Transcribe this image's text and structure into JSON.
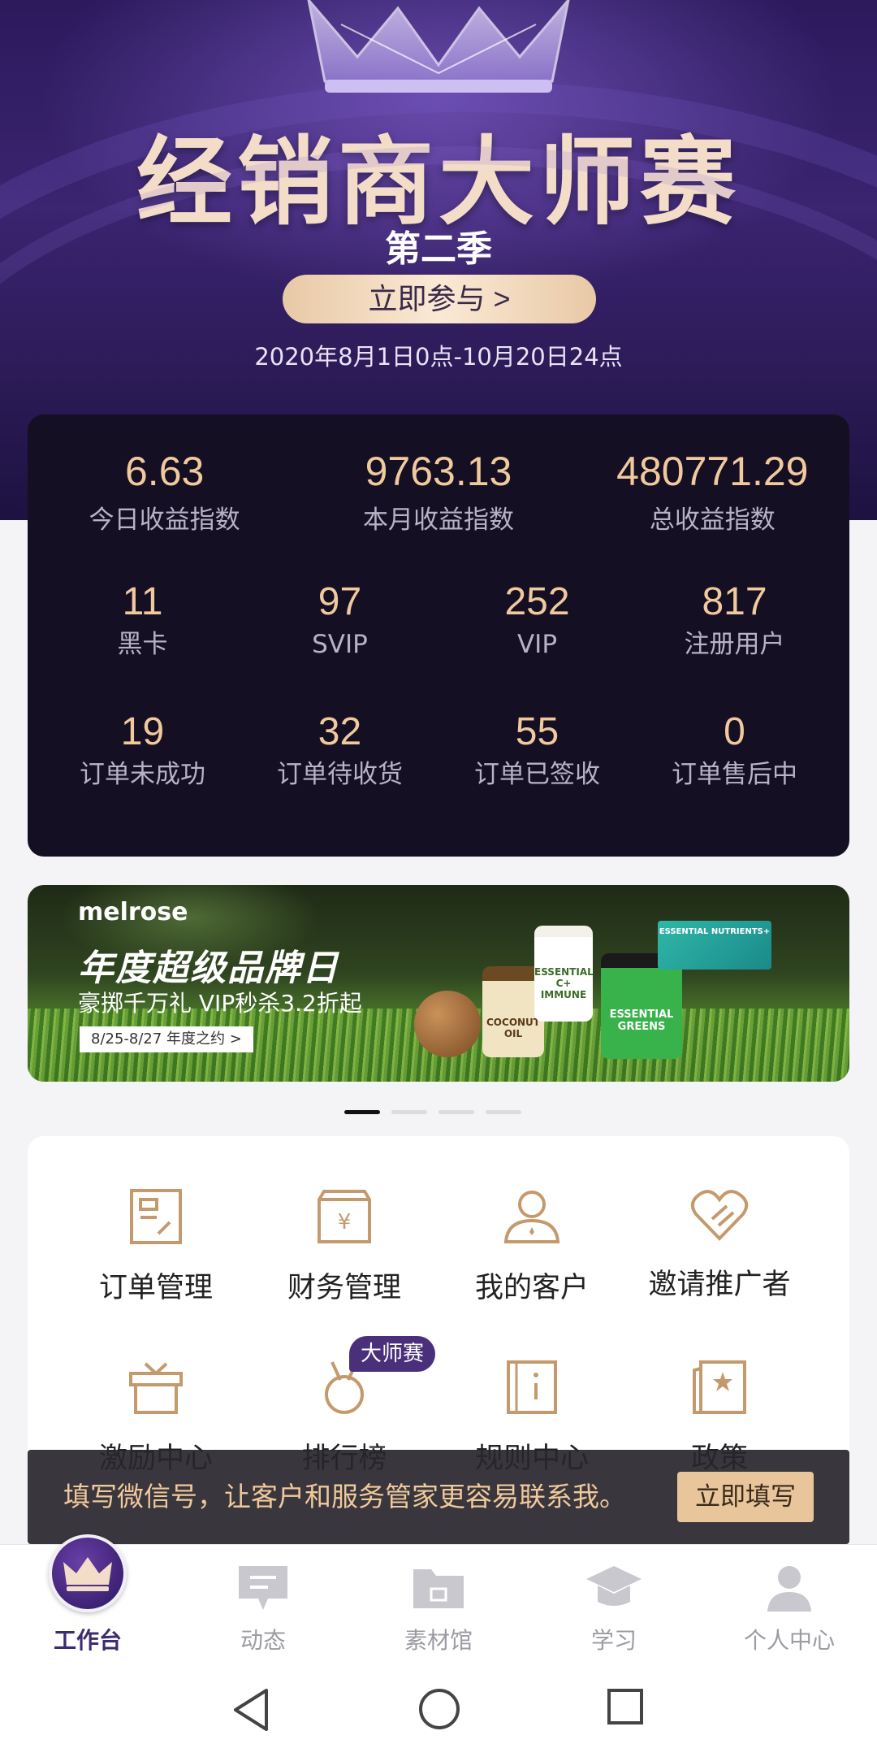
{
  "hero": {
    "title": "经销商大师赛",
    "subtitle": "第二季",
    "join_button": "立即参与 >",
    "date_range": "2020年8月1日0点-10月20日24点"
  },
  "stats": {
    "top": [
      {
        "value": "6.63",
        "label": "今日收益指数"
      },
      {
        "value": "9763.13",
        "label": "本月收益指数"
      },
      {
        "value": "480771.29",
        "label": "总收益指数"
      }
    ],
    "members": [
      {
        "value": "11",
        "label": "黑卡"
      },
      {
        "value": "97",
        "label": "SVIP"
      },
      {
        "value": "252",
        "label": "VIP"
      },
      {
        "value": "817",
        "label": "注册用户"
      }
    ],
    "orders": [
      {
        "value": "19",
        "label": "订单未成功"
      },
      {
        "value": "32",
        "label": "订单待收货"
      },
      {
        "value": "55",
        "label": "订单已签收"
      },
      {
        "value": "0",
        "label": "订单售后中"
      }
    ]
  },
  "banner": {
    "brand": "melrose",
    "headline": "年度超级品牌日",
    "subline": "豪掷千万礼 VIP秒杀3.2折起",
    "tag": "8/25-8/27  年度之约 >",
    "products": [
      "COCONUT OIL",
      "ESSENTIAL C+ IMMUNE",
      "ESSENTIAL GREENS",
      "ESSENTIAL NUTRIENTS+"
    ],
    "pager": {
      "count": 4,
      "active": 0
    }
  },
  "menu": [
    {
      "label": "订单管理",
      "icon": "order-icon"
    },
    {
      "label": "财务管理",
      "icon": "finance-icon"
    },
    {
      "label": "我的客户",
      "icon": "customer-icon"
    },
    {
      "label": "邀请推广者",
      "icon": "invite-icon"
    },
    {
      "label": "激励中心",
      "icon": "gift-icon"
    },
    {
      "label": "排行榜",
      "icon": "medal-icon"
    },
    {
      "label": "规则中心",
      "icon": "rules-icon"
    },
    {
      "label": "政策",
      "icon": "policy-icon"
    }
  ],
  "ranking_badge": "大师赛",
  "toast": {
    "text": "填写微信号，让客户和服务管家更容易联系我。",
    "button": "立即填写"
  },
  "tabs": [
    {
      "label": "工作台",
      "icon": "crown-icon",
      "active": true
    },
    {
      "label": "动态",
      "icon": "chat-icon",
      "active": false
    },
    {
      "label": "素材馆",
      "icon": "folder-icon",
      "active": false
    },
    {
      "label": "学习",
      "icon": "graduation-cap-icon",
      "active": false
    },
    {
      "label": "个人中心",
      "icon": "person-icon",
      "active": false
    }
  ],
  "colors": {
    "accent_gold": "#f0c99c",
    "hero_purple": "#2b1a5c",
    "card_dark": "#150f24",
    "active_tab": "#3d2c70"
  }
}
